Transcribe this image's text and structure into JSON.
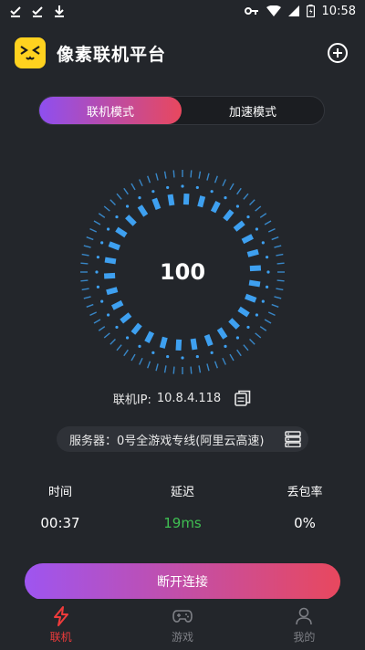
{
  "status_bar": {
    "time": "10:58"
  },
  "header": {
    "title": "像素联机平台"
  },
  "mode": {
    "tabs": [
      {
        "label": "联机模式",
        "active": true
      },
      {
        "label": "加速模式",
        "active": false
      }
    ]
  },
  "meter": {
    "value": "100",
    "accent": "#3ea0f0"
  },
  "connection": {
    "ip_label": "联机IP:",
    "ip_value": "10.8.4.118"
  },
  "server": {
    "text": "服务器：0号全游戏专线(阿里云高速)"
  },
  "stats": [
    {
      "label": "时间",
      "value": "00:37"
    },
    {
      "label": "延迟",
      "value": "19ms"
    },
    {
      "label": "丢包率",
      "value": "0%"
    }
  ],
  "action": {
    "label": "断开连接"
  },
  "nav": [
    {
      "label": "联机",
      "icon": "bolt-icon",
      "active": true
    },
    {
      "label": "游戏",
      "icon": "gamepad-icon",
      "active": false
    },
    {
      "label": "我的",
      "icon": "person-icon",
      "active": false
    }
  ],
  "colors": {
    "bg": "#23262b",
    "ring": "#3ea0f0",
    "active_nav": "#ee3b3b",
    "latency": "#3fbf52"
  }
}
